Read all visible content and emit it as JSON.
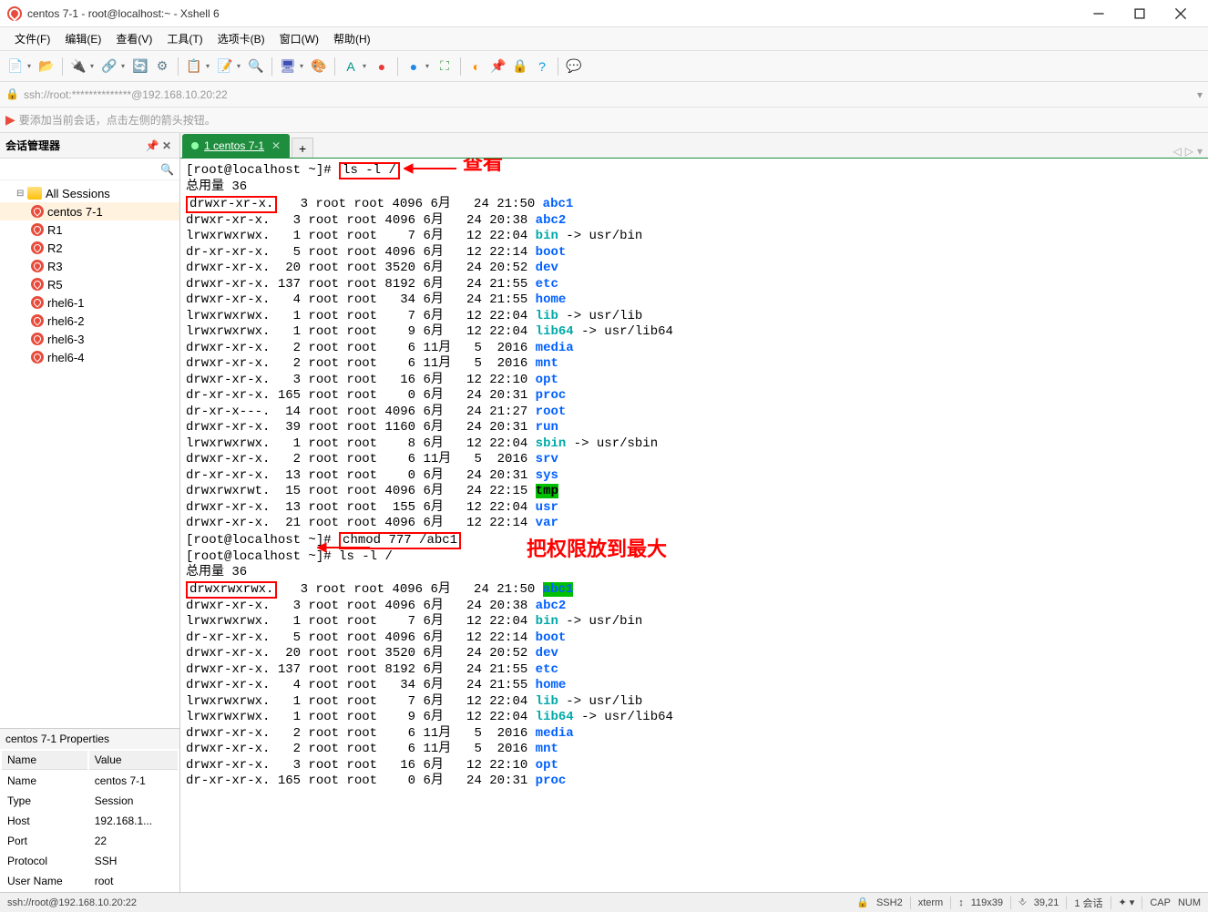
{
  "window": {
    "title": "centos 7-1 - root@localhost:~ - Xshell 6"
  },
  "menu": [
    "文件(F)",
    "编辑(E)",
    "查看(V)",
    "工具(T)",
    "选项卡(B)",
    "窗口(W)",
    "帮助(H)"
  ],
  "toolbar_icons": [
    {
      "name": "new-session-icon",
      "glyph": "📄",
      "color": "#4caf50"
    },
    {
      "name": "open-icon",
      "glyph": "📂",
      "color": "#ff9800"
    },
    {
      "name": "connect-icon",
      "glyph": "🔌",
      "color": "#2196f3"
    },
    {
      "name": "disconnect-icon",
      "glyph": "🔗",
      "color": "#e91e63"
    },
    {
      "name": "reconnect-icon",
      "glyph": "🔄",
      "color": "#9c27b0"
    },
    {
      "name": "properties-icon",
      "glyph": "⚙",
      "color": "#607d8b"
    },
    {
      "name": "copy-icon",
      "glyph": "📋",
      "color": "#00bcd4"
    },
    {
      "name": "paste-icon",
      "glyph": "📝",
      "color": "#ff5722"
    },
    {
      "name": "find-icon",
      "glyph": "🔍",
      "color": "#795548"
    },
    {
      "name": "screen-icon",
      "glyph": "🖥",
      "color": "#3f51b5"
    },
    {
      "name": "color-icon",
      "glyph": "🎨",
      "color": "#f44336"
    },
    {
      "name": "font-icon",
      "glyph": "A",
      "color": "#009688"
    },
    {
      "name": "red-ball-icon",
      "glyph": "●",
      "color": "#e53935"
    },
    {
      "name": "blue-ball-icon",
      "glyph": "●",
      "color": "#1e88e5"
    },
    {
      "name": "fullscreen-icon",
      "glyph": "⛶",
      "color": "#43a047"
    },
    {
      "name": "transparent-icon",
      "glyph": "◐",
      "color": "#fb8c00"
    },
    {
      "name": "ontop-icon",
      "glyph": "📌",
      "color": "#8e24aa"
    },
    {
      "name": "lock-icon",
      "glyph": "🔒",
      "color": "#6d4c41"
    },
    {
      "name": "help-icon",
      "glyph": "?",
      "color": "#039be5"
    },
    {
      "name": "chat-icon",
      "glyph": "💬",
      "color": "#00897b"
    }
  ],
  "address": "ssh://root:**************@192.168.10.20:22",
  "hint": "要添加当前会话，点击左侧的箭头按钮。",
  "session_panel": {
    "title": "会话管理器",
    "root": "All Sessions",
    "sessions": [
      "centos 7-1",
      "R1",
      "R2",
      "R3",
      "R5",
      "rhel6-1",
      "rhel6-2",
      "rhel6-3",
      "rhel6-4"
    ]
  },
  "properties": {
    "title": "centos 7-1 Properties",
    "headers": [
      "Name",
      "Value"
    ],
    "rows": [
      [
        "Name",
        "centos 7-1"
      ],
      [
        "Type",
        "Session"
      ],
      [
        "Host",
        "192.168.1..."
      ],
      [
        "Port",
        "22"
      ],
      [
        "Protocol",
        "SSH"
      ],
      [
        "User Name",
        "root"
      ]
    ]
  },
  "tab": {
    "label": "1 centos 7-1"
  },
  "annotations": {
    "view": "查看",
    "maxperm": "把权限放到最大"
  },
  "terminal": {
    "prompt": "[root@localhost ~]#",
    "cmd1": "ls -l /",
    "total": "总用量 36",
    "cmd2": "chmod 777 /abc1",
    "cmd3": "ls -l /",
    "entries1": [
      {
        "perm": "drwxr-xr-x.",
        "n": "3",
        "own": "root root",
        "size": "4096",
        "mon": "6月",
        "day": "24",
        "time": "21:50",
        "name": "abc1",
        "cls": "blue",
        "box": true
      },
      {
        "perm": "drwxr-xr-x.",
        "n": "3",
        "own": "root root",
        "size": "4096",
        "mon": "6月",
        "day": "24",
        "time": "20:38",
        "name": "abc2",
        "cls": "blue"
      },
      {
        "perm": "lrwxrwxrwx.",
        "n": "1",
        "own": "root root",
        "size": "7",
        "mon": "6月",
        "day": "12",
        "time": "22:04",
        "name": "bin",
        "cls": "cyan",
        "link": " -> usr/bin"
      },
      {
        "perm": "dr-xr-xr-x.",
        "n": "5",
        "own": "root root",
        "size": "4096",
        "mon": "6月",
        "day": "12",
        "time": "22:14",
        "name": "boot",
        "cls": "blue"
      },
      {
        "perm": "drwxr-xr-x.",
        "n": "20",
        "own": "root root",
        "size": "3520",
        "mon": "6月",
        "day": "24",
        "time": "20:52",
        "name": "dev",
        "cls": "blue"
      },
      {
        "perm": "drwxr-xr-x.",
        "n": "137",
        "own": "root root",
        "size": "8192",
        "mon": "6月",
        "day": "24",
        "time": "21:55",
        "name": "etc",
        "cls": "blue"
      },
      {
        "perm": "drwxr-xr-x.",
        "n": "4",
        "own": "root root",
        "size": "34",
        "mon": "6月",
        "day": "24",
        "time": "21:55",
        "name": "home",
        "cls": "blue"
      },
      {
        "perm": "lrwxrwxrwx.",
        "n": "1",
        "own": "root root",
        "size": "7",
        "mon": "6月",
        "day": "12",
        "time": "22:04",
        "name": "lib",
        "cls": "cyan",
        "link": " -> usr/lib"
      },
      {
        "perm": "lrwxrwxrwx.",
        "n": "1",
        "own": "root root",
        "size": "9",
        "mon": "6月",
        "day": "12",
        "time": "22:04",
        "name": "lib64",
        "cls": "cyan",
        "link": " -> usr/lib64"
      },
      {
        "perm": "drwxr-xr-x.",
        "n": "2",
        "own": "root root",
        "size": "6",
        "mon": "11月",
        "day": "5",
        "time": "2016",
        "name": "media",
        "cls": "blue"
      },
      {
        "perm": "drwxr-xr-x.",
        "n": "2",
        "own": "root root",
        "size": "6",
        "mon": "11月",
        "day": "5",
        "time": "2016",
        "name": "mnt",
        "cls": "blue"
      },
      {
        "perm": "drwxr-xr-x.",
        "n": "3",
        "own": "root root",
        "size": "16",
        "mon": "6月",
        "day": "12",
        "time": "22:10",
        "name": "opt",
        "cls": "blue"
      },
      {
        "perm": "dr-xr-xr-x.",
        "n": "165",
        "own": "root root",
        "size": "0",
        "mon": "6月",
        "day": "24",
        "time": "20:31",
        "name": "proc",
        "cls": "blue"
      },
      {
        "perm": "dr-xr-x---.",
        "n": "14",
        "own": "root root",
        "size": "4096",
        "mon": "6月",
        "day": "24",
        "time": "21:27",
        "name": "root",
        "cls": "blue"
      },
      {
        "perm": "drwxr-xr-x.",
        "n": "39",
        "own": "root root",
        "size": "1160",
        "mon": "6月",
        "day": "24",
        "time": "20:31",
        "name": "run",
        "cls": "blue"
      },
      {
        "perm": "lrwxrwxrwx.",
        "n": "1",
        "own": "root root",
        "size": "8",
        "mon": "6月",
        "day": "12",
        "time": "22:04",
        "name": "sbin",
        "cls": "cyan",
        "link": " -> usr/sbin"
      },
      {
        "perm": "drwxr-xr-x.",
        "n": "2",
        "own": "root root",
        "size": "6",
        "mon": "11月",
        "day": "5",
        "time": "2016",
        "name": "srv",
        "cls": "blue"
      },
      {
        "perm": "dr-xr-xr-x.",
        "n": "13",
        "own": "root root",
        "size": "0",
        "mon": "6月",
        "day": "24",
        "time": "20:31",
        "name": "sys",
        "cls": "blue"
      },
      {
        "perm": "drwxrwxrwt.",
        "n": "15",
        "own": "root root",
        "size": "4096",
        "mon": "6月",
        "day": "24",
        "time": "22:15",
        "name": "tmp",
        "cls": "green-bg"
      },
      {
        "perm": "drwxr-xr-x.",
        "n": "13",
        "own": "root root",
        "size": "155",
        "mon": "6月",
        "day": "12",
        "time": "22:04",
        "name": "usr",
        "cls": "blue"
      },
      {
        "perm": "drwxr-xr-x.",
        "n": "21",
        "own": "root root",
        "size": "4096",
        "mon": "6月",
        "day": "12",
        "time": "22:14",
        "name": "var",
        "cls": "blue"
      }
    ],
    "entries2": [
      {
        "perm": "drwxrwxrwx.",
        "n": "3",
        "own": "root root",
        "size": "4096",
        "mon": "6月",
        "day": "24",
        "time": "21:50",
        "name": "abc1",
        "cls": "green-bg2",
        "box": true
      },
      {
        "perm": "drwxr-xr-x.",
        "n": "3",
        "own": "root root",
        "size": "4096",
        "mon": "6月",
        "day": "24",
        "time": "20:38",
        "name": "abc2",
        "cls": "blue"
      },
      {
        "perm": "lrwxrwxrwx.",
        "n": "1",
        "own": "root root",
        "size": "7",
        "mon": "6月",
        "day": "12",
        "time": "22:04",
        "name": "bin",
        "cls": "cyan",
        "link": " -> usr/bin"
      },
      {
        "perm": "dr-xr-xr-x.",
        "n": "5",
        "own": "root root",
        "size": "4096",
        "mon": "6月",
        "day": "12",
        "time": "22:14",
        "name": "boot",
        "cls": "blue"
      },
      {
        "perm": "drwxr-xr-x.",
        "n": "20",
        "own": "root root",
        "size": "3520",
        "mon": "6月",
        "day": "24",
        "time": "20:52",
        "name": "dev",
        "cls": "blue"
      },
      {
        "perm": "drwxr-xr-x.",
        "n": "137",
        "own": "root root",
        "size": "8192",
        "mon": "6月",
        "day": "24",
        "time": "21:55",
        "name": "etc",
        "cls": "blue"
      },
      {
        "perm": "drwxr-xr-x.",
        "n": "4",
        "own": "root root",
        "size": "34",
        "mon": "6月",
        "day": "24",
        "time": "21:55",
        "name": "home",
        "cls": "blue"
      },
      {
        "perm": "lrwxrwxrwx.",
        "n": "1",
        "own": "root root",
        "size": "7",
        "mon": "6月",
        "day": "12",
        "time": "22:04",
        "name": "lib",
        "cls": "cyan",
        "link": " -> usr/lib"
      },
      {
        "perm": "lrwxrwxrwx.",
        "n": "1",
        "own": "root root",
        "size": "9",
        "mon": "6月",
        "day": "12",
        "time": "22:04",
        "name": "lib64",
        "cls": "cyan",
        "link": " -> usr/lib64"
      },
      {
        "perm": "drwxr-xr-x.",
        "n": "2",
        "own": "root root",
        "size": "6",
        "mon": "11月",
        "day": "5",
        "time": "2016",
        "name": "media",
        "cls": "blue"
      },
      {
        "perm": "drwxr-xr-x.",
        "n": "2",
        "own": "root root",
        "size": "6",
        "mon": "11月",
        "day": "5",
        "time": "2016",
        "name": "mnt",
        "cls": "blue"
      },
      {
        "perm": "drwxr-xr-x.",
        "n": "3",
        "own": "root root",
        "size": "16",
        "mon": "6月",
        "day": "12",
        "time": "22:10",
        "name": "opt",
        "cls": "blue"
      },
      {
        "perm": "dr-xr-xr-x.",
        "n": "165",
        "own": "root root",
        "size": "0",
        "mon": "6月",
        "day": "24",
        "time": "20:31",
        "name": "proc",
        "cls": "blue"
      }
    ]
  },
  "statusbar": {
    "left": "ssh://root@192.168.10.20:22",
    "r1": "SSH2",
    "r2": "xterm",
    "r3": "119x39",
    "r4": "39,21",
    "r5": "1 会话",
    "r6": "CAP",
    "r7": "NUM"
  }
}
